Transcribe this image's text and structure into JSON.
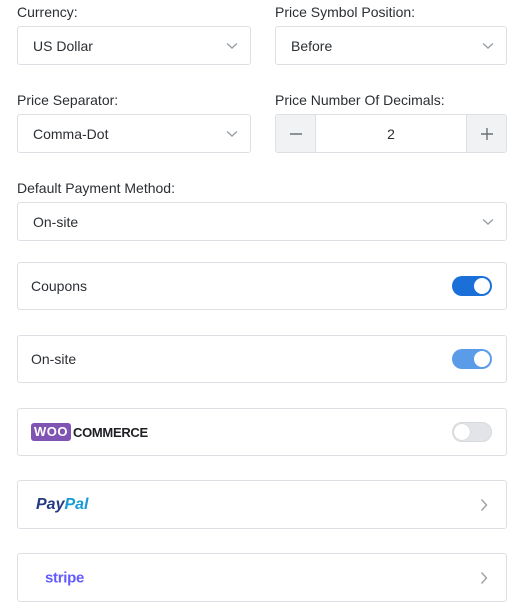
{
  "currency": {
    "label": "Currency:",
    "value": "US Dollar"
  },
  "price_symbol_position": {
    "label": "Price Symbol Position:",
    "value": "Before"
  },
  "price_separator": {
    "label": "Price Separator:",
    "value": "Comma-Dot"
  },
  "price_decimals": {
    "label": "Price Number Of Decimals:",
    "value": "2",
    "decrement_icon": "minus-icon",
    "increment_icon": "plus-icon"
  },
  "default_payment_method": {
    "label": "Default Payment Method:",
    "value": "On-site"
  },
  "cards": {
    "coupons": {
      "label": "Coupons",
      "enabled": true,
      "toggle_color": "#1a6fd8"
    },
    "onsite": {
      "label": "On-site",
      "enabled": true,
      "toggle_color": "#5b9ce8"
    },
    "woocommerce": {
      "logo_woo": "WOO",
      "logo_commerce": "COMMERCE",
      "enabled": false,
      "logo_color": "#7f54b3"
    },
    "paypal": {
      "logo_pay": "Pay",
      "logo_pal": "Pal"
    },
    "stripe": {
      "logo": "stripe",
      "logo_color": "#635bff"
    }
  },
  "colors": {
    "border": "#dcdfe3",
    "toggle_off": "#e2e4e8",
    "text": "#2b2f33"
  }
}
